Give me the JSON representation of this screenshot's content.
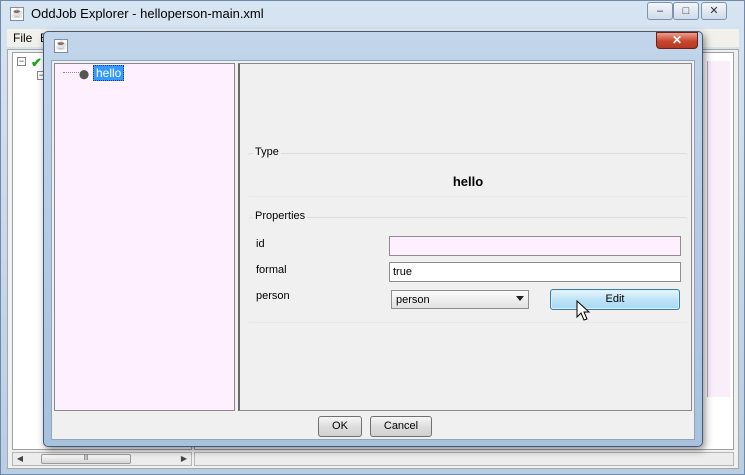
{
  "main_window": {
    "title": "OddJob Explorer - helloperson-main.xml",
    "controls": {
      "minimize": "‒",
      "maximize": "□",
      "close": "✕"
    },
    "menu": {
      "file": "File",
      "edit": "E"
    },
    "status_icon": "check-icon",
    "scrollbar_grip": "lll"
  },
  "dialog": {
    "close": "✕",
    "tree": {
      "node_label": "hello"
    },
    "type_group": {
      "title": "Type",
      "value": "hello"
    },
    "properties_group": {
      "title": "Properties",
      "id": {
        "label": "id",
        "value": ""
      },
      "formal": {
        "label": "formal",
        "value": "true"
      },
      "person": {
        "label": "person",
        "selected": "person",
        "edit_label": "Edit"
      }
    },
    "buttons": {
      "ok": "OK",
      "cancel": "Cancel"
    }
  },
  "colors": {
    "tree_background": "#fef0fe",
    "selection": "#3399ff",
    "edit_button": "#bfe3f7",
    "close_button": "#c9452d"
  }
}
